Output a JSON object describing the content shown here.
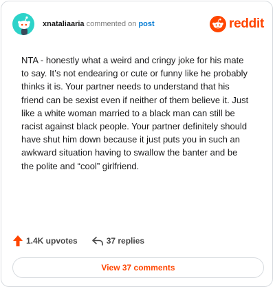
{
  "comment": {
    "username": "xnataliaaria",
    "verb": "commented on",
    "target_label": "post",
    "body": "NTA - honestly what a weird and cringy joke for his mate to say. It’s not endearing or cute or funny like he probably thinks it is. Your partner needs to understand that his friend can be sexist even if neither of them believe it. Just like a white woman married to a black man can still be racist against black people. Your partner definitely should have shut him down because it just puts you in such an awkward situation having to swallow the banter and be the polite and “cool” girlfriend."
  },
  "brand": {
    "name": "reddit",
    "color": "#ff4500",
    "icon": "reddit-snoo-icon"
  },
  "avatar": {
    "icon": "snoo-avatar-icon",
    "background": "#2dd3c9"
  },
  "actions": {
    "upvotes_label": "1.4K upvotes",
    "upvote_icon": "upvote-arrow-icon",
    "replies_label": "37 replies",
    "reply_icon": "reply-arrow-icon"
  },
  "footer": {
    "view_comments_label": "View 37 comments"
  }
}
